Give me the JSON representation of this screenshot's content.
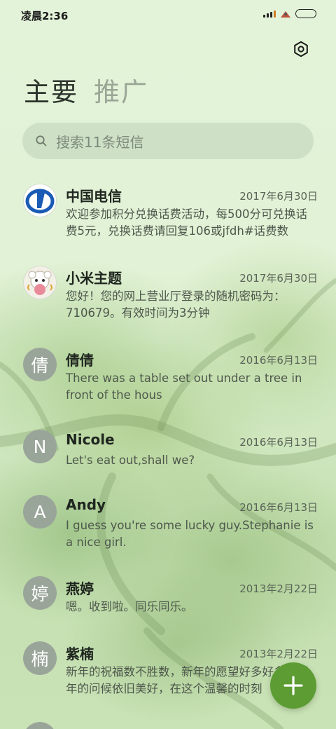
{
  "status_bar": {
    "time": "凌晨2:36"
  },
  "tabs": [
    {
      "label": "主要",
      "active": true
    },
    {
      "label": "推广",
      "active": false
    }
  ],
  "search": {
    "placeholder": "搜索11条短信"
  },
  "conversations": [
    {
      "name": "中国电信",
      "date": "2017年6月30日",
      "preview": "欢迎参加积分兑换话费活动，每500分可兑换话费5元，兑换话费请回复106或jfdh#话费数",
      "avatar_type": "china-telecom-logo"
    },
    {
      "name": "小米主题",
      "date": "2017年6月30日",
      "preview": "您好！您的网上营业厅登录的随机密码为：710679。有效时间为3分钟",
      "avatar_type": "mi-theme-logo"
    },
    {
      "name": "倩倩",
      "date": "2016年6月13日",
      "preview": "There was a table set out under a tree in front of the hous",
      "avatar_letter": "倩"
    },
    {
      "name": "Nicole",
      "date": "2016年6月13日",
      "preview": "Let's eat out,shall we?",
      "avatar_letter": "N"
    },
    {
      "name": "Andy",
      "date": "2016年6月13日",
      "preview": "I guess you're some lucky guy.Stephanie is a nice girl.",
      "avatar_letter": "A"
    },
    {
      "name": "燕婷",
      "date": "2013年2月22日",
      "preview": "嗯。收到啦。同乐同乐。",
      "avatar_letter": "婷"
    },
    {
      "name": "紫楠",
      "date": "2013年2月22日",
      "preview": "新年的祝福数不胜数，新年的愿望好多好多，新年的问候依旧美好，在这个温馨的时刻",
      "avatar_letter": "楠"
    }
  ],
  "fab": {
    "icon": "plus-icon",
    "color": "#5c9c33"
  },
  "colors": {
    "accent": "#5c9c33",
    "avatar_bg": "#9aa59a"
  }
}
